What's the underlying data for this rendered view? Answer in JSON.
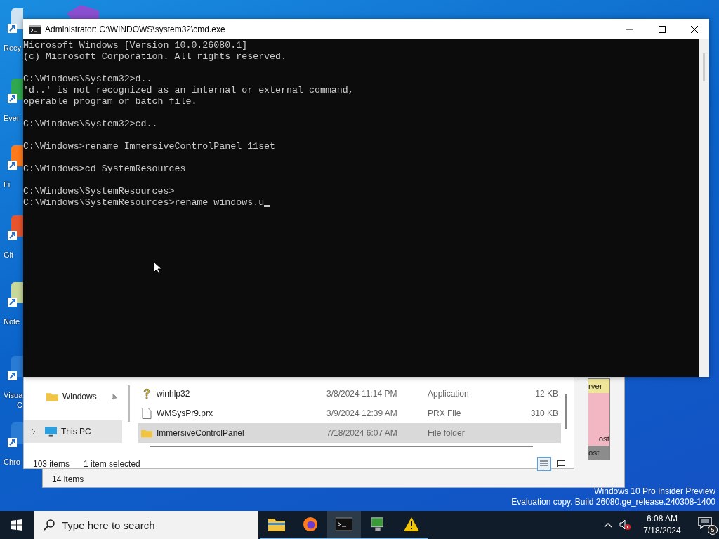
{
  "desktop_icons": [
    {
      "label": "Recy"
    },
    {
      "label": "Ever"
    },
    {
      "label": "Fi"
    },
    {
      "label": "Git"
    },
    {
      "label": "Note"
    },
    {
      "label": "Visua",
      "label_line_2": "C"
    },
    {
      "label": "Chro"
    }
  ],
  "back_window": {
    "status": "14 items",
    "cells": [
      {
        "text": "rver",
        "color": "#efe69a"
      },
      {
        "text": "ost",
        "color": "#f3b7c3"
      },
      {
        "text": "ost",
        "color": "#8c8c8c"
      }
    ]
  },
  "explorer": {
    "nav_items": [
      {
        "label": "Windows",
        "kind": "pinned_folder"
      },
      {
        "label": "This PC",
        "kind": "computer"
      }
    ],
    "files": [
      {
        "kind": "help",
        "name": "winhlp32",
        "date": "3/8/2024 11:14 PM",
        "type": "Application",
        "size": "12 KB",
        "selected": false
      },
      {
        "kind": "file",
        "name": "WMSysPr9.prx",
        "date": "3/9/2024 12:39 AM",
        "type": "PRX File",
        "size": "310 KB",
        "selected": false
      },
      {
        "kind": "folder",
        "name": "ImmersiveControlPanel",
        "date": "7/18/2024 6:07 AM",
        "type": "File folder",
        "selected": true
      }
    ],
    "status": {
      "items": "103 items",
      "selection": "1 item selected"
    },
    "views": [
      {
        "kind": "details",
        "selected": true
      },
      {
        "kind": "preview",
        "selected": false
      }
    ]
  },
  "cmd": {
    "title": "Administrator: C:\\WINDOWS\\system32\\cmd.exe",
    "blocks": [
      [
        "Microsoft Windows [Version 10.0.26080.1]",
        "(c) Microsoft Corporation. All rights reserved."
      ],
      [
        "C:\\Windows\\System32>d..",
        "'d..' is not recognized as an internal or external command,",
        "operable program or batch file."
      ],
      [
        "C:\\Windows\\System32>cd.."
      ],
      [
        "C:\\Windows>rename ImmersiveControlPanel 11set"
      ],
      [
        "C:\\Windows>cd SystemResources"
      ],
      [
        "C:\\Windows\\SystemResources>",
        "C:\\Windows\\SystemResources>rename windows.u"
      ]
    ]
  },
  "watermark": [
    "Windows 10 Pro Insider Preview",
    "Evaluation copy. Build 26080.ge_release.240308-1400"
  ],
  "taskbar": {
    "search": {
      "placeholder": "Type here to search"
    },
    "apps": [
      {
        "kind": "folder",
        "active": false
      },
      {
        "kind": "browser",
        "active": false
      },
      {
        "kind": "terminal",
        "active": true
      },
      {
        "kind": "network",
        "active": false
      },
      {
        "kind": "warning",
        "active": false
      }
    ],
    "time": "6:08 AM",
    "date": "7/18/2024",
    "notifications": "5"
  }
}
